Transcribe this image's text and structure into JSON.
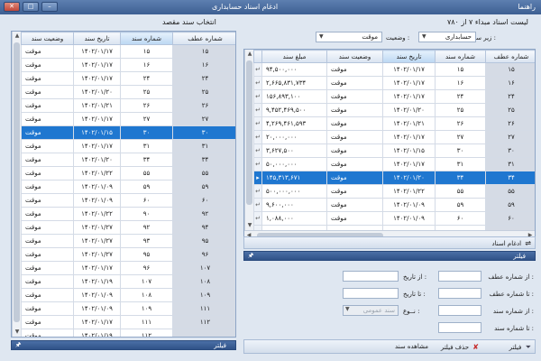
{
  "window": {
    "title": "ادغام اسناد حسابداری",
    "help": "راهنما"
  },
  "left": {
    "title": "انتخاب سند مقصد",
    "columns": [
      "شماره عطف",
      "شماره سند",
      "تاریخ سند",
      "وضعیت سند"
    ],
    "rows": [
      [
        "۱۵",
        "۱۵",
        "۱۴۰۲/۰۱/۱۷",
        "موقت"
      ],
      [
        "۱۶",
        "۱۶",
        "۱۴۰۲/۰۱/۱۷",
        "موقت"
      ],
      [
        "۲۴",
        "۲۴",
        "۱۴۰۲/۰۱/۱۷",
        "موقت"
      ],
      [
        "۲۵",
        "۲۵",
        "۱۴۰۲/۰۱/۲۰",
        "موقت"
      ],
      [
        "۲۶",
        "۲۶",
        "۱۴۰۲/۰۱/۲۱",
        "موقت"
      ],
      [
        "۲۷",
        "۲۷",
        "۱۴۰۲/۰۱/۱۷",
        "موقت"
      ],
      [
        "۳۰",
        "۳۰",
        "۱۴۰۲/۰۱/۱۵",
        "موقت"
      ],
      [
        "۳۱",
        "۳۱",
        "۱۴۰۲/۰۱/۱۷",
        "موقت"
      ],
      [
        "۳۴",
        "۳۴",
        "۱۴۰۲/۰۱/۲۰",
        "موقت"
      ],
      [
        "۵۵",
        "۵۵",
        "۱۴۰۲/۰۱/۲۲",
        "موقت"
      ],
      [
        "۵۹",
        "۵۹",
        "۱۴۰۲/۰۱/۰۹",
        "موقت"
      ],
      [
        "۶۰",
        "۶۰",
        "۱۴۰۲/۰۱/۰۹",
        "موقت"
      ],
      [
        "۹۲",
        "۹۰",
        "۱۴۰۲/۰۱/۲۲",
        "موقت"
      ],
      [
        "۹۴",
        "۹۲",
        "۱۴۰۲/۰۱/۲۷",
        "موقت"
      ],
      [
        "۹۵",
        "۹۳",
        "۱۴۰۲/۰۱/۲۷",
        "موقت"
      ],
      [
        "۹۶",
        "۹۵",
        "۱۴۰۲/۰۱/۲۷",
        "موقت"
      ],
      [
        "۱۰۷",
        "۹۶",
        "۱۴۰۲/۰۱/۱۷",
        "موقت"
      ],
      [
        "۱۰۸",
        "۱۰۷",
        "۱۴۰۲/۰۱/۱۹",
        "موقت"
      ],
      [
        "۱۰۹",
        "۱۰۸",
        "۱۴۰۲/۰۱/۰۹",
        "موقت"
      ],
      [
        "۱۱۱",
        "۱۰۹",
        "۱۴۰۲/۰۱/۰۹",
        "موقت"
      ],
      [
        "۱۱۲",
        "۱۱۱",
        "۱۴۰۲/۰۱/۱۷",
        "موقت"
      ],
      [
        "",
        "۱۱۲",
        "۱۴۰۲/۰۱/۱۹",
        "موقت"
      ]
    ],
    "selected_row": 6,
    "filter_label": "فیلتر"
  },
  "right": {
    "header": "لیست اسناد مبداء ۷ از ۷۸۰",
    "subsystem_label": "زیر سیستم :",
    "subsystem_value": "حسابداری",
    "status_label": "وضعیت :",
    "status_value": "موقت",
    "columns": [
      "شماره عطف",
      "شماره سند",
      "تاریخ سند",
      "وضعیت سند",
      "مبلغ سند"
    ],
    "rows": [
      [
        "۱۵",
        "۱۵",
        "۱۴۰۲/۰۱/۱۷",
        "موقت",
        "۹۴,۵۰۰,۰۰۰"
      ],
      [
        "۱۶",
        "۱۶",
        "۱۴۰۲/۰۱/۱۷",
        "موقت",
        "۲,۶۶۵,۸۳۱,۷۳۴"
      ],
      [
        "۲۴",
        "۲۴",
        "۱۴۰۲/۰۱/۱۷",
        "موقت",
        "۱۵۶,۸۹۳,۱۰۰"
      ],
      [
        "۲۵",
        "۲۵",
        "۱۴۰۲/۰۱/۲۰",
        "موقت",
        "۹,۴۵۲,۴۶۹,۵۰۰"
      ],
      [
        "۲۶",
        "۲۶",
        "۱۴۰۲/۰۱/۲۱",
        "موقت",
        "۴,۲۶۹,۴۶۱,۵۹۳"
      ],
      [
        "۲۷",
        "۲۷",
        "۱۴۰۲/۰۱/۱۷",
        "موقت",
        "۲۰,۰۰۰,۰۰۰"
      ],
      [
        "۳۰",
        "۳۰",
        "۱۴۰۲/۰۱/۱۵",
        "موقت",
        "۳,۶۲۷,۵۰۰"
      ],
      [
        "۳۱",
        "۳۱",
        "۱۴۰۲/۰۱/۱۷",
        "موقت",
        "۵۰,۰۰۰,۰۰۰"
      ],
      [
        "۳۴",
        "۳۴",
        "۱۴۰۲/۰۱/۲۰",
        "موقت",
        "۱۴۵,۳۱۳,۶۷۱"
      ],
      [
        "۵۵",
        "۵۵",
        "۱۴۰۲/۰۱/۲۲",
        "موقت",
        "۵۰۰,۰۰۰,۰۰۰"
      ],
      [
        "۵۹",
        "۵۹",
        "۱۴۰۲/۰۱/۰۹",
        "موقت",
        "۹,۶۰۰,۰۰۰"
      ],
      [
        "۶۰",
        "۶۰",
        "۱۴۰۲/۰۱/۰۹",
        "موقت",
        "۱,۰۸۸,۰۰۰"
      ],
      [
        "",
        "",
        "",
        "",
        ""
      ]
    ],
    "selected_row": 8,
    "merge_title": "ادغام اسناد",
    "filter_title": "فیلتر",
    "filters": {
      "from_ref": "از شماره عطف :",
      "to_ref": "تا شماره عطف :",
      "from_doc": "از شماره سند :",
      "to_doc": "تا شماره سند :",
      "from_date": "از تاریخ :",
      "to_date": "تا تاریخ :",
      "type": "نــوع :",
      "type_value": "سند عمومی"
    },
    "toolbar": {
      "filter": "فیلتر",
      "remove_filter": "حذف فیلتر",
      "view_doc": "مشاهده سند"
    }
  }
}
